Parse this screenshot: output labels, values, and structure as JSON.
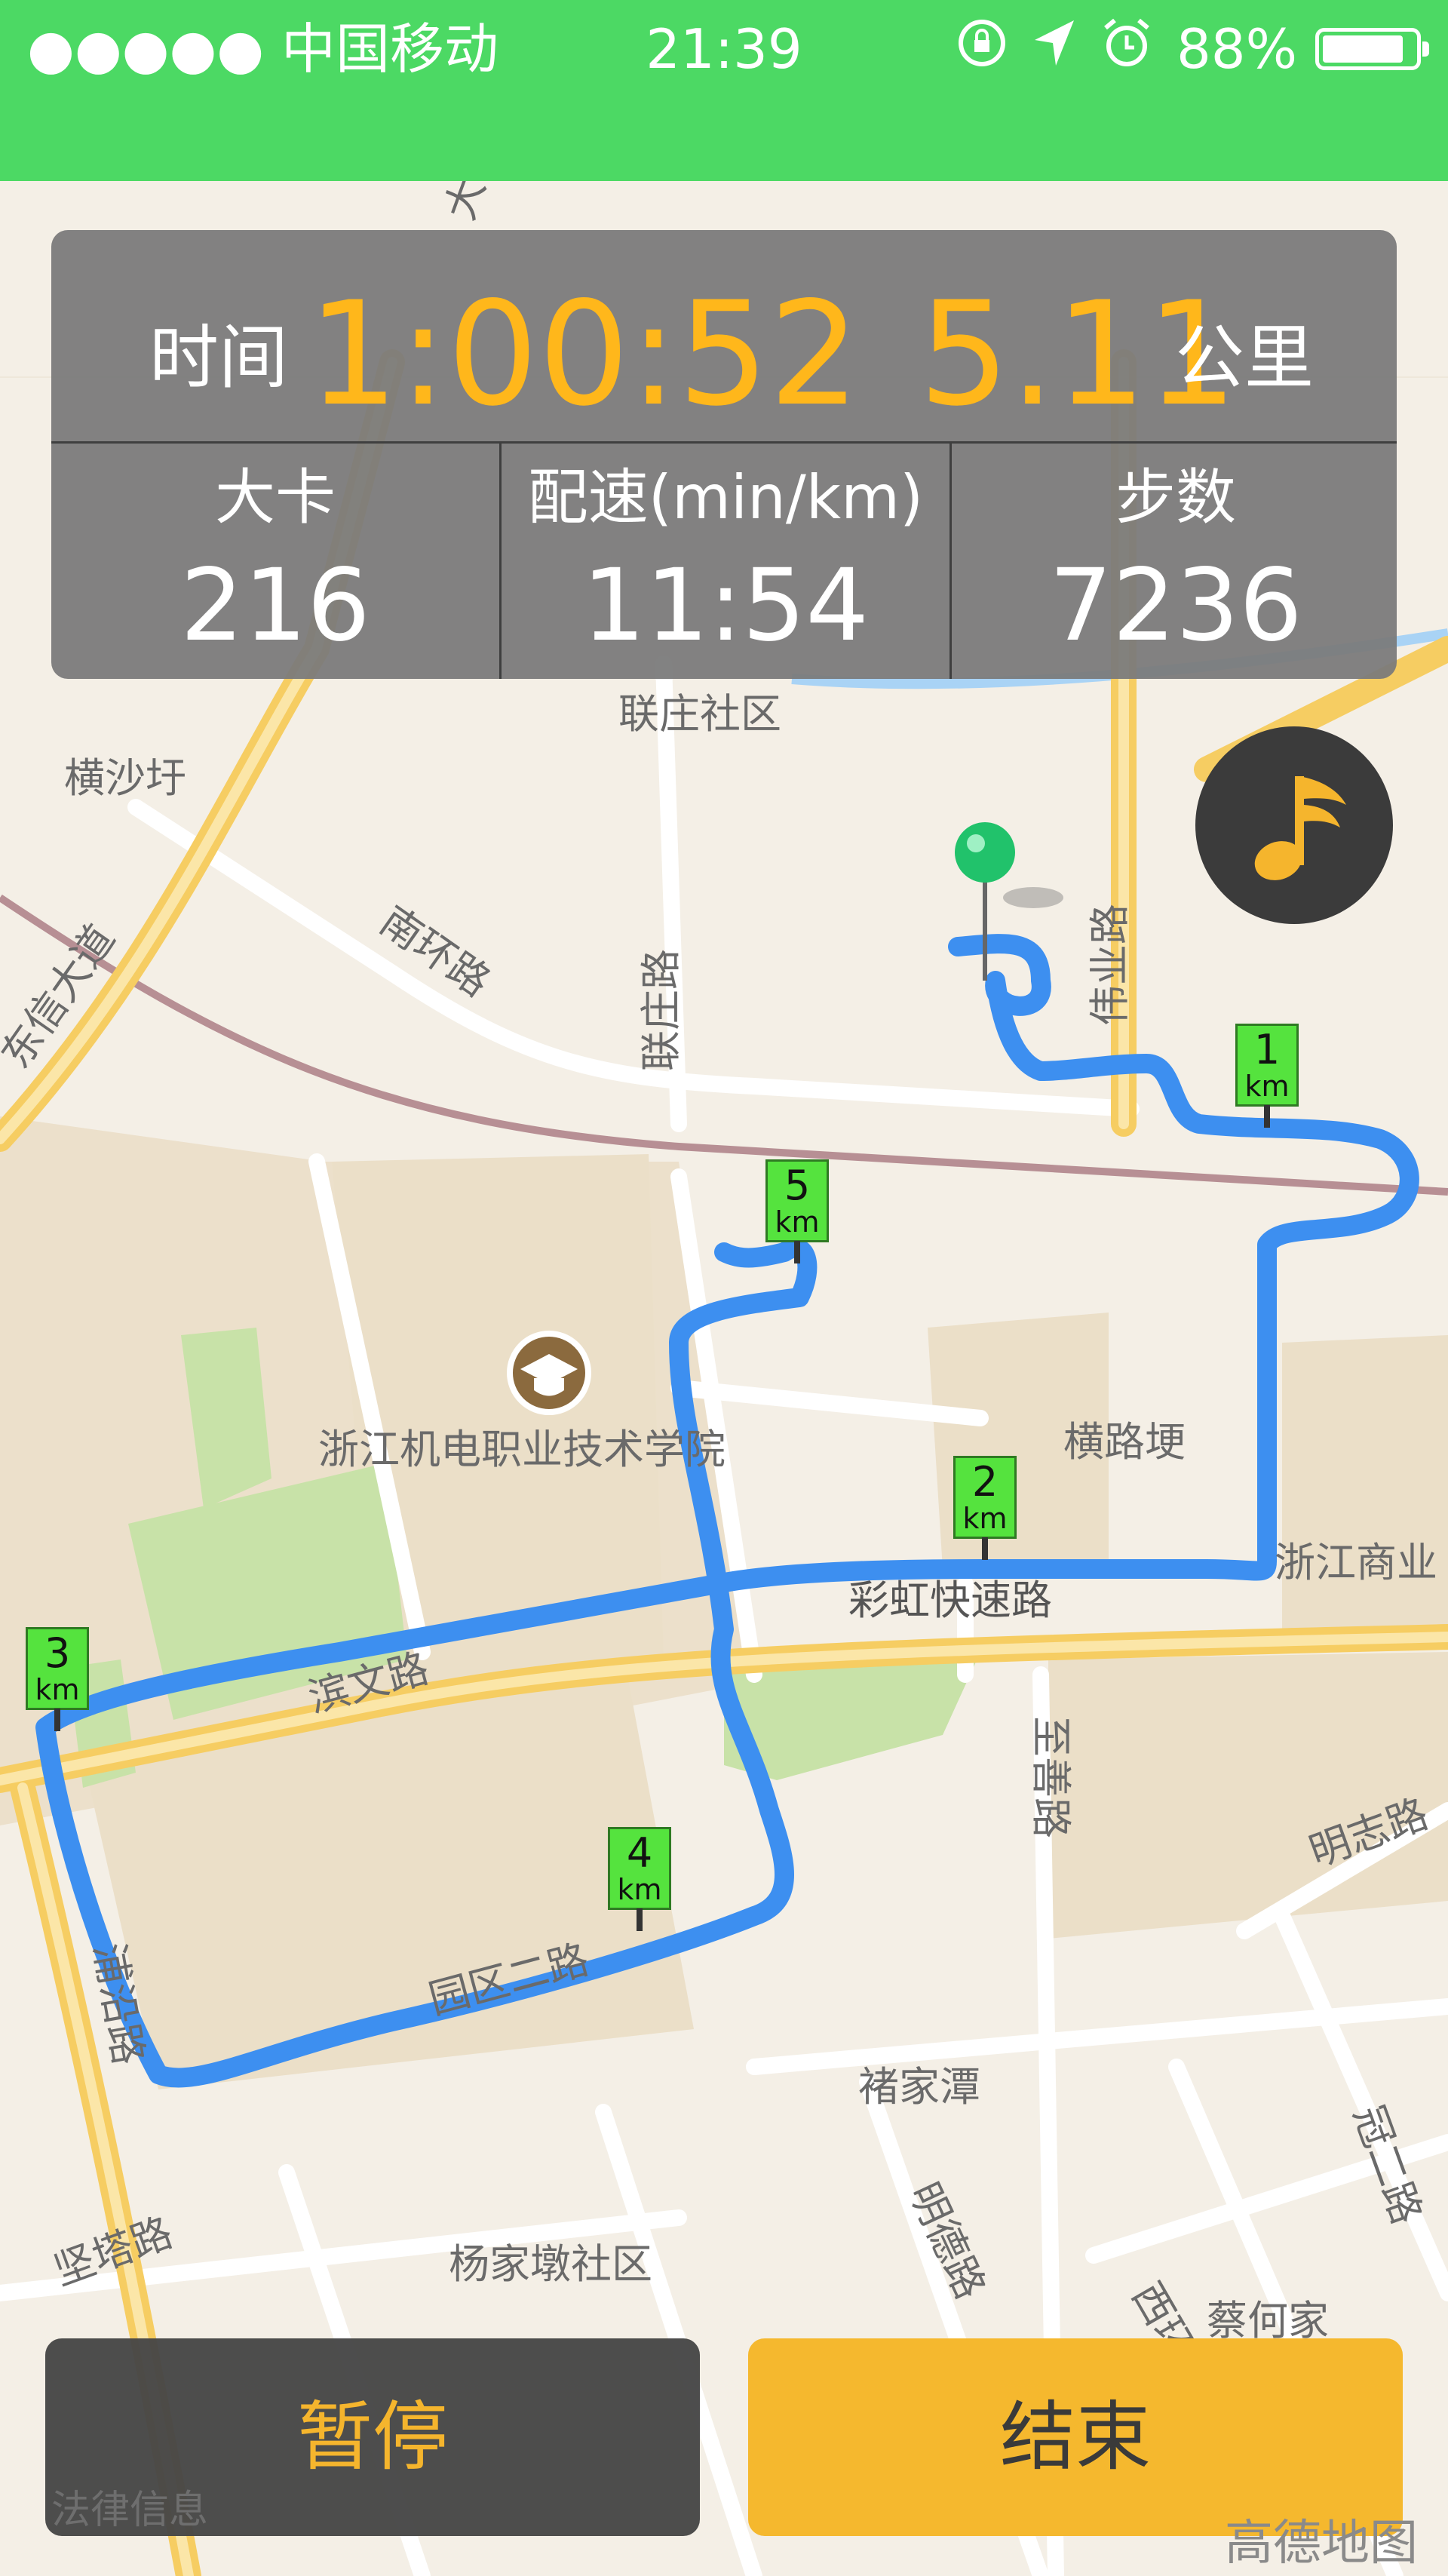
{
  "status_bar": {
    "carrier": "●●●●● 中国移动",
    "time": "21:39",
    "battery": "88%",
    "battery_fraction": 0.88,
    "icons": [
      "rotation-lock-icon",
      "location-arrow-icon",
      "alarm-icon"
    ]
  },
  "stats": {
    "time_label": "时间",
    "time_value": "1:00:52",
    "distance_value": "5.11",
    "distance_unit": "公里",
    "calories_label": "大卡",
    "calories_value": "216",
    "pace_label": "配速(min/km)",
    "pace_value": "11:54",
    "steps_label": "步数",
    "steps_value": "7236"
  },
  "km_markers": [
    "1",
    "2",
    "3",
    "4",
    "5"
  ],
  "km_unit": "km",
  "map_labels": {
    "lianzhuang_community": "联庄社区",
    "hengshayu": "横沙圩",
    "weiye_road": "伟业路",
    "nanhuan_road": "南环路",
    "lianzhuang_road": "联庄路",
    "dongxin_avenue": "东信大道",
    "college": "浙江机电职业技术学院",
    "henglugeng": "横路埂",
    "caihong_expressway": "彩虹快速路",
    "zhejiang_commerce": "浙江商业",
    "binwen_road": "滨文路",
    "zhishan_road": "至善路",
    "mingzhi_road": "明志路",
    "park_2nd_road": "园区二路",
    "puyan_road": "浦沿路",
    "zhujiatan": "褚家潭",
    "jianta_road": "坚塔路",
    "yangjiadun_community": "杨家墩社区",
    "mingde_road": "明德路",
    "xihuan_road": "西环路",
    "caihejia": "蔡何家",
    "guaner_road": "冠二路",
    "datong": "大"
  },
  "buttons": {
    "pause": "暂停",
    "end": "结束"
  },
  "legal": "法律信息",
  "brand": "高德地图",
  "colors": {
    "status_green": "#4cd964",
    "route_blue": "#3d8ff0",
    "accent_orange": "#ffb71b",
    "marker_green": "#55e33e"
  }
}
